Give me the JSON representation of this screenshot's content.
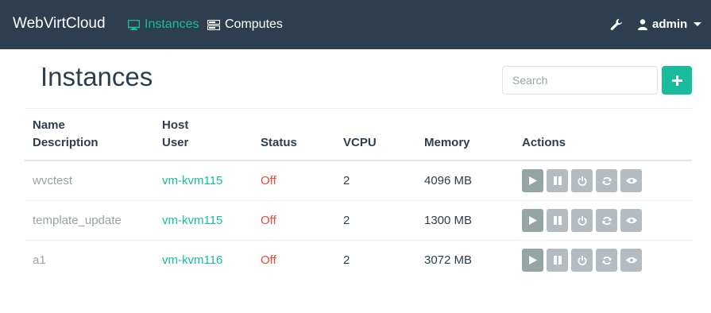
{
  "app": {
    "brand": "WebVirtCloud"
  },
  "nav": {
    "instances_label": "Instances",
    "computes_label": "Computes",
    "user_label": "admin"
  },
  "page": {
    "title": "Instances",
    "search_placeholder": "Search"
  },
  "table": {
    "headers": {
      "name": "Name",
      "description": "Description",
      "host": "Host",
      "user": "User",
      "status": "Status",
      "vcpu": "VCPU",
      "memory": "Memory",
      "actions": "Actions"
    },
    "rows": [
      {
        "name": "wvctest",
        "host": "vm-kvm115",
        "status": "Off",
        "vcpu": "2",
        "memory": "4096 MB"
      },
      {
        "name": "template_update",
        "host": "vm-kvm115",
        "status": "Off",
        "vcpu": "2",
        "memory": "1300 MB"
      },
      {
        "name": "a1",
        "host": "vm-kvm116",
        "status": "Off",
        "vcpu": "2",
        "memory": "3072 MB"
      }
    ]
  },
  "icons": {
    "instances": "monitor-icon",
    "computes": "server-icon",
    "settings": "wrench-icon",
    "user": "user-icon",
    "add": "plus-icon",
    "row_actions": [
      "play-icon",
      "pause-icon",
      "power-icon",
      "refresh-icon",
      "eye-icon"
    ]
  },
  "colors": {
    "navbar": "#2c3e50",
    "accent": "#18bc9c",
    "status_off": "#e74c3c",
    "muted": "#95a5a6"
  }
}
